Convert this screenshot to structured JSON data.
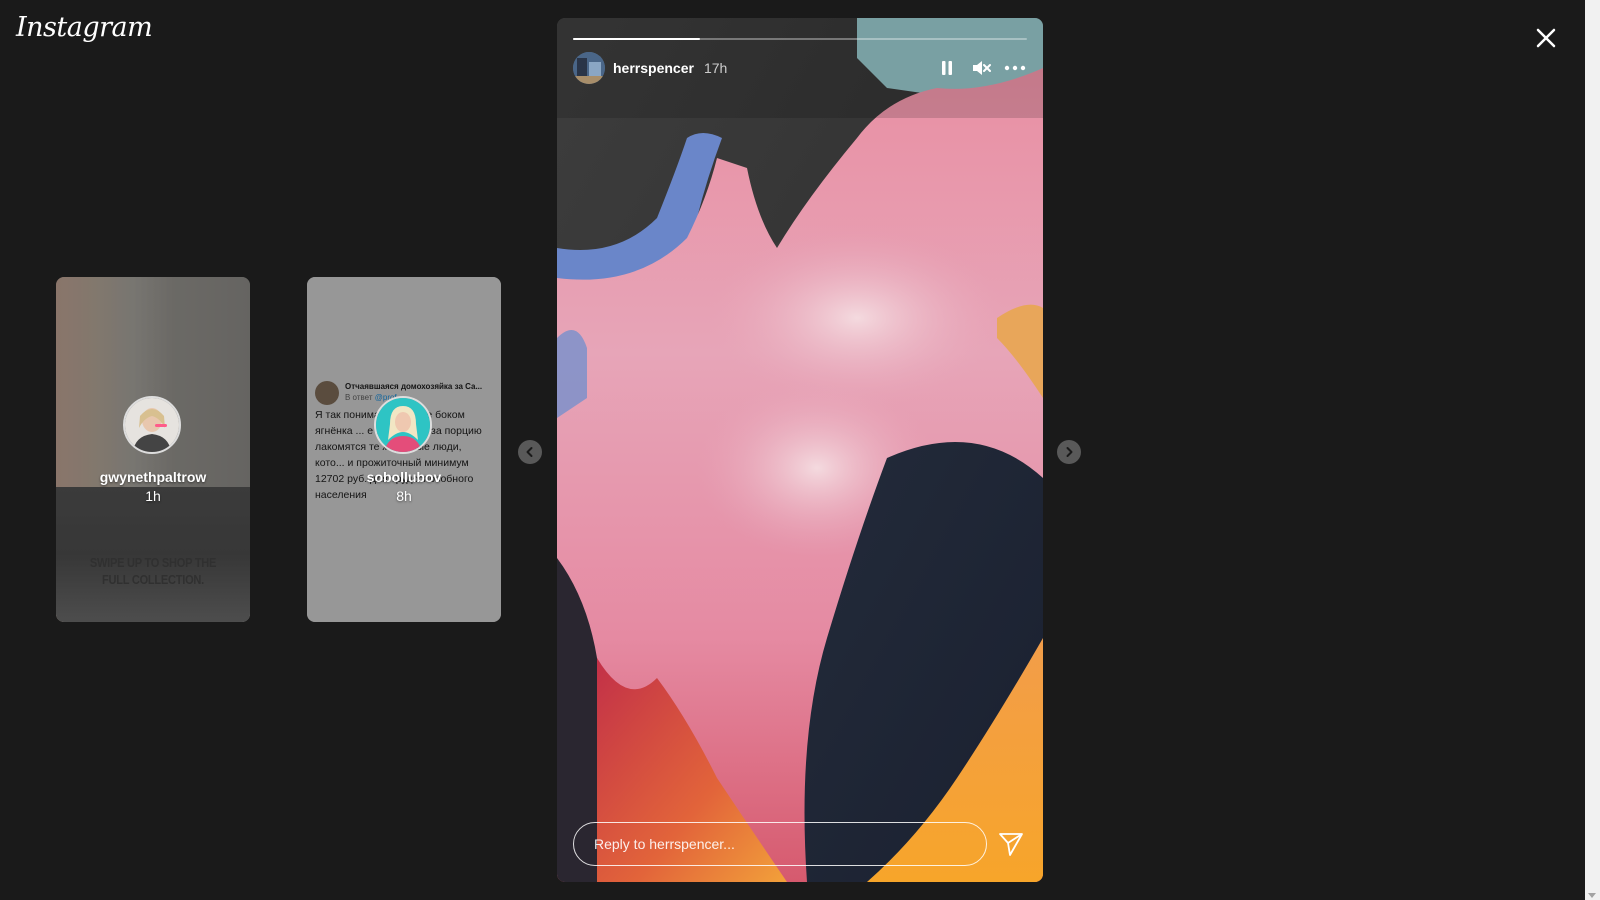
{
  "app": {
    "logo_text": "Instagram"
  },
  "previews": [
    {
      "username": "gwynethpaltrow",
      "time": "1h",
      "overlay_text": "SWIPE UP TO SHOP THE FULL COLLECTION."
    },
    {
      "username": "sobollubov",
      "time": "8h",
      "tweet": {
        "author": "Отчаявшаяся домохозяйка за Са...",
        "reply_to": "В ответ",
        "reply_handle": "@prof_",
        "body": "Я так понимаю ... ЭМФе боком ягнёнка ... е 17000 руб. за порцию лакомятся те же самые люди, кото... и прожиточный минимум 12702 руб. для трудоспособного населения"
      }
    }
  ],
  "story": {
    "username": "herrspencer",
    "time": "17h",
    "progress": 0.28,
    "reply_placeholder": "Reply to herrspencer..."
  },
  "icons": {
    "close": "close-icon",
    "pause": "pause-icon",
    "mute": "muted-speaker-icon",
    "more": "more-options-icon",
    "send": "paper-plane-icon",
    "prev": "chevron-left-icon",
    "next": "chevron-right-icon"
  }
}
